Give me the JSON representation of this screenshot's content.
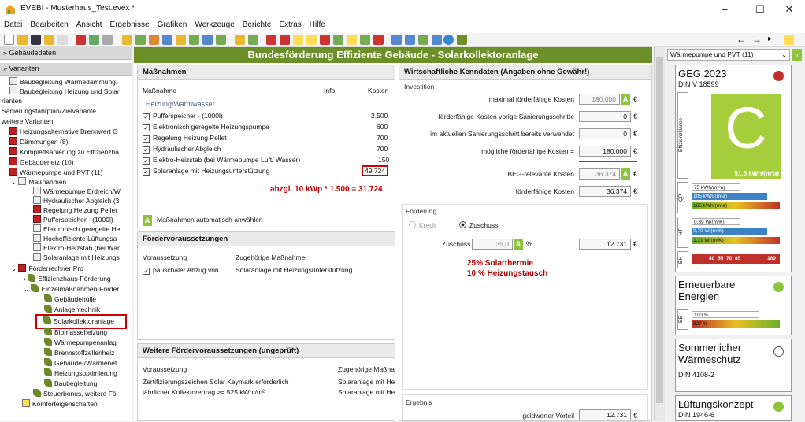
{
  "window": {
    "title": "EVEBI - Musterhaus_Test.evex *",
    "min": "–",
    "max": "☐",
    "close": "✕"
  },
  "menu": [
    "Datei",
    "Bearbeiten",
    "Ansicht",
    "Ergebnisse",
    "Grafiken",
    "Werkzeuge",
    "Berichte",
    "Extras",
    "Hilfe"
  ],
  "left": {
    "hdr_gebaeude": "Gebäudedaten",
    "hdr_varianten": "Varianten",
    "tree": [
      "Baubegleitung Wärmedämmung,",
      "Baubegleitung Heizung und Solar",
      "rianten",
      "Sanierungsfahrplan/Zielvariante",
      "weitere Varianten",
      "Heizungsalternative Brennwert G",
      "Dämmungen (8)",
      "Komplettsanierung zu Effizienzha",
      "Gebäudenetz (10)",
      "Wärmepumpe und PVT (11)",
      "Maßnahmen",
      "Wärmepumpe Erdreich/W",
      "Hydraulischer Abgleich (3",
      "Regelung Heizung Pellet",
      "Pufferspeicher - (1000l)",
      "Elektronisch geregelte He",
      "Hocheffiziente Lüftungsa",
      "Elektro-Heizstab (bei Wär",
      "Solaranlage mit Heizungs",
      "Förderrechner Pro",
      "Effizienzhaus-Förderung",
      "Einzelmaßnahmen-Förder",
      "Gebäudehülle",
      "Anlagentechnik",
      "Solarkollektoranlage",
      "Biomasseheizung",
      "Wärmepumpenanlag",
      "Brennstoffzellenheiz",
      "Gebäude-/Wärmenet",
      "Heizungsoptimierung",
      "Baubegleitung",
      "Steuerbonus, weitere Fö",
      "Komforteigenschaften"
    ]
  },
  "center": {
    "title": "Bundesförderung Effiziente Gebäude - Solarkollektoranlage",
    "massnahmen": {
      "header": "Maßnahmen",
      "col_m": "Maßnahme",
      "col_info": "Info",
      "col_kosten": "Kosten",
      "group": "Heizung/Warmwasser",
      "rows": [
        {
          "name": "Pufferspeicher - (1000l)",
          "cost": "2.500"
        },
        {
          "name": "Elektronisch geregelte Heizungspumpe",
          "cost": "600"
        },
        {
          "name": "Regelung Heizung Pellet",
          "cost": "700"
        },
        {
          "name": "Hydraulischer Abgleich",
          "cost": "700"
        },
        {
          "name": "Elektro-Heizstab (bei Wärmepumpe Luft/ Wasser)",
          "cost": "150"
        },
        {
          "name": "Solaranlage mit Heizungsunterstützung",
          "cost": "49.724"
        }
      ],
      "note": "abzgl. 10 kWp * 1.500 = 31.724",
      "auto": "Maßnahmen automatisch anwählen"
    },
    "foerder": {
      "header": "Fördervoraussetzungen",
      "col_v": "Voraussetzung",
      "col_m": "Zugehörige Maßnahme",
      "v": "pauschaler Abzug von ...",
      "m": "Solaranlage mit Heizungsunterstützung"
    },
    "weitere": {
      "header": "Weitere Fördervoraussetzungen (ungeprüft)",
      "col_v": "Voraussetzung",
      "col_m": "Zugehörige Maßna",
      "r1": "Zertifizierungszeichen Solar Keymark erforderlich",
      "r2": "jährlicher Kollektorertrag >= 525 kWh /m²",
      "m1": "Solaranlage mit He",
      "m2": "Solaranlage mit He"
    },
    "wirt": {
      "header": "Wirtschaftliche Kenndaten (Angaben ohne Gewähr!)",
      "invest": "Investition",
      "l1": "maximal förderfähige Kosten",
      "v1": "180.000",
      "l2": "förderfähige Kosten vorige Sanierungsschritte",
      "v2": "0",
      "l3": "im aktuellen Sanierungsschritt bereits verwendet",
      "v3": "0",
      "l4": "mögliche förderfähige Kosten =",
      "v4": "180.000",
      "l5": "BEG-relevante Kosten",
      "v5": "36.374",
      "l6": "förderfähige Kosten",
      "v6": "36.374",
      "foerderung": "Förderung",
      "kredit": "Kredit",
      "zuschuss": "Zuschuss",
      "zlabel": "Zuschuss",
      "zpct": "35,0",
      "pct": "%",
      "zval": "12.731",
      "red1": "25% Solarthermie",
      "red2": "10 % Heizungstausch",
      "ergebnis": "Ergebnis",
      "gv": "geldwerter Vorteil",
      "gvval": "12.731",
      "euro": "€",
      "a": "A"
    }
  },
  "right": {
    "dropdown": "Wärmepumpe und PVT (11)",
    "geg": {
      "title": "GEG 2023",
      "sub": "DIN V 18599",
      "letter": "C",
      "value": "91,5 kWh/(m²a)",
      "eff": "Effizienzklasse",
      "qp": [
        "75 kWh/(m²a)",
        "105 kWh/(m²a)",
        "165 kWh/(m²a)"
      ],
      "ht": [
        "0,39 W/(m²K)",
        "0,70 W/(m²K)",
        "1,21 W/(m²K)"
      ],
      "eh": [
        "40",
        "55",
        "70",
        "85",
        "160"
      ],
      "lqp": "QP",
      "lht": "HT",
      "leh": "EH"
    },
    "ee": {
      "title": "Erneuerbare Energien",
      "b1": "100 %",
      "b2": "327 %",
      "l": "EE"
    },
    "som": {
      "title": "Sommerlicher Wärmeschutz",
      "sub": "DIN 4108-2"
    },
    "lueft": {
      "title": "Lüftungskonzept",
      "sub": "DIN 1946-6"
    }
  },
  "colors": {
    "green": "#6d8f2a",
    "accent": "#8cc43c",
    "red": "#c00000"
  }
}
